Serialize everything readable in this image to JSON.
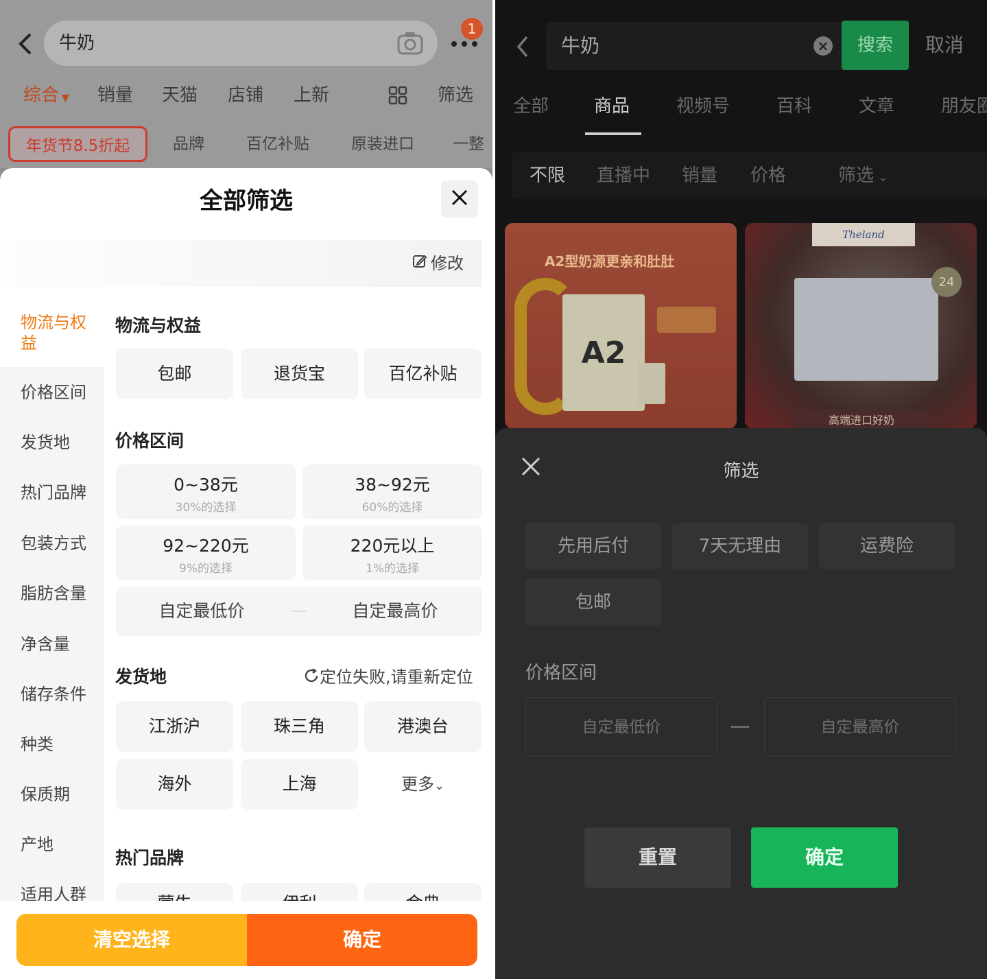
{
  "left": {
    "search": {
      "query": "牛奶"
    },
    "notification_count": "1",
    "tabs": [
      {
        "label": "综合"
      },
      {
        "label": "销量"
      },
      {
        "label": "天猫"
      },
      {
        "label": "店铺"
      },
      {
        "label": "上新"
      },
      {
        "label": "筛选"
      }
    ],
    "chips": [
      {
        "label": "年货节8.5折起"
      },
      {
        "label": "品牌"
      },
      {
        "label": "百亿补贴"
      },
      {
        "label": "原装进口"
      },
      {
        "label": "一整"
      }
    ],
    "sheet": {
      "title": "全部筛选",
      "edit_label": "修改",
      "side_nav": [
        "物流与权益",
        "价格区间",
        "发货地",
        "热门品牌",
        "包装方式",
        "脂肪含量",
        "净含量",
        "储存条件",
        "种类",
        "保质期",
        "产地",
        "适用人群"
      ],
      "logistics": {
        "title": "物流与权益",
        "options": [
          "包邮",
          "退货宝",
          "百亿补贴"
        ]
      },
      "price": {
        "title": "价格区间",
        "ranges": [
          {
            "label": "0~38元",
            "note": "30%的选择"
          },
          {
            "label": "38~92元",
            "note": "60%的选择"
          },
          {
            "label": "92~220元",
            "note": "9%的选择"
          },
          {
            "label": "220元以上",
            "note": "1%的选择"
          }
        ],
        "min_placeholder": "自定最低价",
        "max_placeholder": "自定最高价"
      },
      "origin": {
        "title": "发货地",
        "relocate": "定位失败,请重新定位",
        "options": [
          "江浙沪",
          "珠三角",
          "港澳台",
          "海外",
          "上海"
        ],
        "more": "更多"
      },
      "brands": {
        "title": "热门品牌",
        "partial": [
          "蒙牛",
          "伊利",
          "金典"
        ]
      },
      "clear_label": "清空选择",
      "confirm_label": "确定"
    },
    "colors": {
      "accent": "#f07b17",
      "clear": "#ffb41b",
      "confirm": "#ff6512",
      "promo": "#cc3b2e"
    }
  },
  "right": {
    "search": {
      "query": "牛奶",
      "button": "搜索",
      "cancel": "取消"
    },
    "tabs": [
      "全部",
      "商品",
      "视频号",
      "百科",
      "文章",
      "朋友圈"
    ],
    "filters": [
      "不限",
      "直播中",
      "销量",
      "价格",
      "筛选"
    ],
    "products": [
      {
        "headline": "A2型奶源更亲和肚肚",
        "badge": "A2"
      },
      {
        "brand": "Theland",
        "caption": "高端进口好奶",
        "badge": "24"
      }
    ],
    "sheet": {
      "title": "筛选",
      "options": [
        "先用后付",
        "7天无理由",
        "运费险",
        "包邮"
      ],
      "price_title": "价格区间",
      "min_placeholder": "自定最低价",
      "max_placeholder": "自定最高价",
      "reset_label": "重置",
      "confirm_label": "确定"
    },
    "colors": {
      "confirm": "#18b459",
      "search_button": "#1a8a49"
    }
  }
}
